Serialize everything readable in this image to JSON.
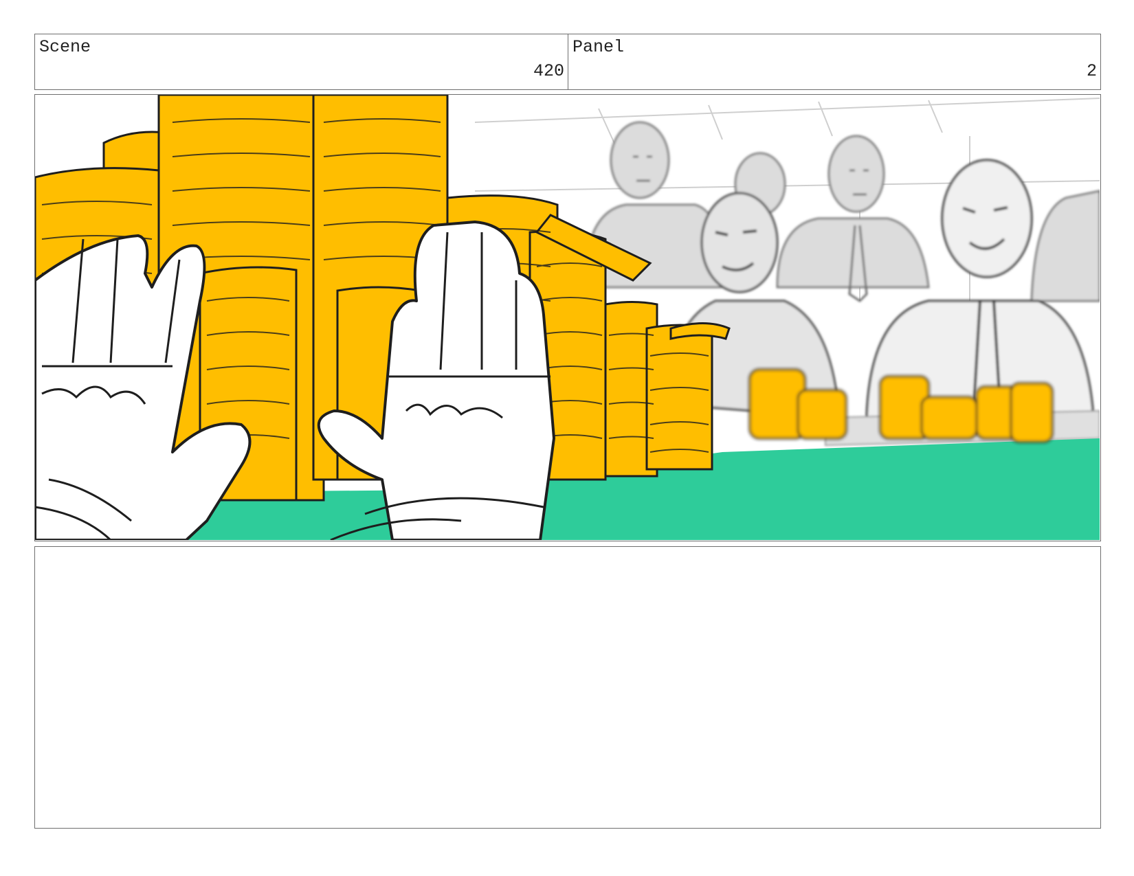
{
  "header": {
    "scene_label": "Scene",
    "scene_number": "420",
    "panel_label": "Panel",
    "panel_number": "2"
  },
  "notes": {
    "text": ""
  },
  "colors": {
    "coin": "#FFBE00",
    "table": "#2ECC9A",
    "line": "#1e1e1e",
    "sketch_gray": "#d9d9d9"
  }
}
